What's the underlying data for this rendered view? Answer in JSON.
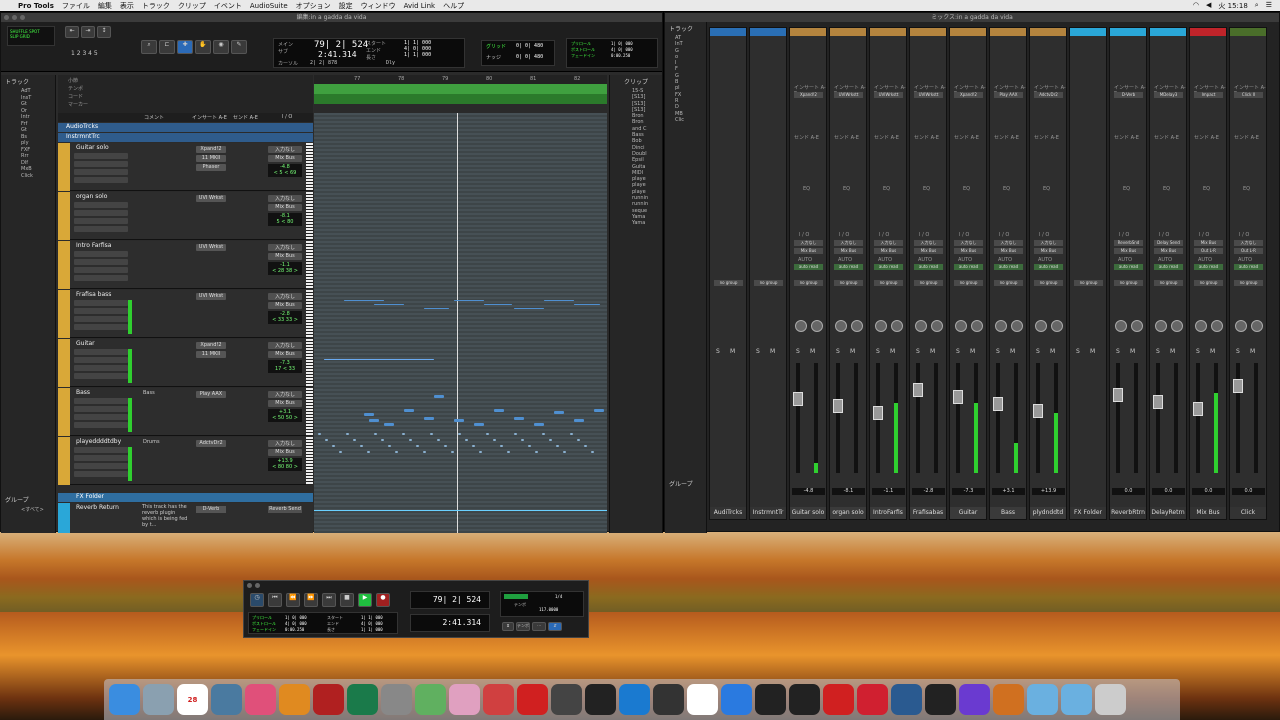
{
  "menubar": {
    "app": "Pro Tools",
    "items": [
      "ファイル",
      "編集",
      "表示",
      "トラック",
      "クリップ",
      "イベント",
      "AudioSuite",
      "オプション",
      "設定",
      "ウィンドウ",
      "Avid Link",
      "ヘルプ"
    ],
    "right": {
      "date": "火 15:18"
    }
  },
  "edit_window": {
    "title": "編集:in a gadda da vida",
    "counter_main": "79| 2| 524",
    "counter_sub": "2:41.314",
    "start": "1| 1| 000",
    "end": "4| 0| 000",
    "length": "1| 1| 000",
    "grid": "0| 0| 480",
    "nudge": "0| 0| 480",
    "cursor_label": "カーソル",
    "cursor_value": "2| 2| 878",
    "dly": "Dly",
    "tracks_label": "トラック",
    "clips_label": "クリップ",
    "group_label": "グループ",
    "group_all": "<すべて>",
    "track_list": [
      "AdT",
      "InsT",
      "Gt",
      "Or",
      "Intr",
      "Frf",
      "Gt",
      "Bs",
      "ply",
      "FXF",
      "Rrr",
      "Dlf",
      "MxB",
      "Click"
    ],
    "columns": [
      "コメント",
      "インサート A-E",
      "センド A-E",
      "I / O"
    ],
    "ruler_labels": [
      "小節",
      "テンポ",
      "コード",
      "マーカー"
    ],
    "folders": [
      "AudioTrcks",
      "InstrmntTrc"
    ],
    "fx_folder": "FX Folder",
    "reverb_track": "Reverb Return",
    "reverb_comment": "This track has the reverb plugin which is being fed by t...",
    "reverb_insert": "D-Verb",
    "reverb_io": "Reverb Send",
    "tracks": [
      {
        "name": "Guitar solo",
        "comment": "",
        "insert": "Xpand!2",
        "insert2": "11 MKII",
        "insert3": "Phaser",
        "io": "入力なし",
        "out": "Mix Bus",
        "vol": "-4.8",
        "pan": "< 5 < 69"
      },
      {
        "name": "organ solo",
        "comment": "",
        "insert": "UVI Wrkst",
        "insert2": "",
        "insert3": "",
        "io": "入力なし",
        "out": "Mix Bus",
        "vol": "-8.1",
        "pan": "5 < 80"
      },
      {
        "name": "Intro Farfisa",
        "comment": "",
        "insert": "UVI Wrkst",
        "insert2": "",
        "insert3": "",
        "io": "入力なし",
        "out": "Mix Bus",
        "vol": "-1.1",
        "pan": "< 28 38 >"
      },
      {
        "name": "Frafisa bass",
        "comment": "",
        "insert": "UVI Wrkst",
        "insert2": "",
        "insert3": "",
        "io": "入力なし",
        "out": "Mix Bus",
        "vol": "-2.8",
        "pan": "< 33 33 >"
      },
      {
        "name": "Guitar",
        "comment": "",
        "insert": "Xpand!2",
        "insert2": "11 MKII",
        "insert3": "",
        "io": "入力なし",
        "out": "Mix Bus",
        "vol": "-7.3",
        "pan": "17 < 33"
      },
      {
        "name": "Bass",
        "comment": "Bass",
        "insert": "Play AAX",
        "insert2": "",
        "insert3": "",
        "io": "入力なし",
        "out": "Mix Bus",
        "vol": "+3.1",
        "pan": "< 50 50 >"
      },
      {
        "name": "playeddddtdby",
        "comment": "Drums",
        "insert": "AdctvDr2",
        "insert2": "",
        "insert3": "",
        "io": "入力なし",
        "out": "Mix Bus",
        "vol": "+13.9",
        "pan": "< 80 80 >"
      }
    ],
    "bar_numbers": [
      "77",
      "78",
      "79",
      "80",
      "81",
      "82"
    ],
    "clip_list": [
      "15-S",
      "[S13]",
      "[S13]",
      "[S13]",
      "Bron",
      "Bron",
      "and C",
      "Bass",
      "Bob",
      "Dinci",
      "Doubl",
      "Epsil",
      "Guita",
      "MIDI",
      "playe",
      "playe",
      "playe",
      "runnin",
      "runnin",
      "seque",
      "Yama",
      "Yama"
    ],
    "clips_side": [
      "AT",
      "InT",
      "G",
      "o",
      "I",
      "F",
      "G",
      "B",
      "pl",
      "FX",
      "R",
      "D",
      "MB",
      "Clic"
    ]
  },
  "mix_window": {
    "title": "ミックス:in a gadda da vida",
    "channels": [
      {
        "name": "AudiTrcks",
        "insert": "",
        "io1": "",
        "io2": "",
        "vol": "",
        "color": "#2a6fb5"
      },
      {
        "name": "InstrmntTr",
        "insert": "",
        "io1": "",
        "io2": "",
        "vol": "",
        "color": "#2a6fb5"
      },
      {
        "name": "Guitar solo",
        "insert": "Xpand!2",
        "io1": "入力なし",
        "io2": "Mix Bus",
        "vol": "-4.8",
        "pk": "-9.4",
        "color": "#b4843e"
      },
      {
        "name": "organ solo",
        "insert": "UVIWrkstt",
        "io1": "入力なし",
        "io2": "Mix Bus",
        "vol": "-8.1",
        "pk": "-7.7",
        "color": "#b4843e"
      },
      {
        "name": "IntroFarfis",
        "insert": "UVIWrkstt",
        "io1": "入力なし",
        "io2": "Mix Bus",
        "vol": "-1.1",
        "pk": "-8.7",
        "color": "#b4843e"
      },
      {
        "name": "Frafisabas",
        "insert": "UVIWrkstt",
        "io1": "入力なし",
        "io2": "Mix Bus",
        "vol": "-2.8",
        "pk": "0.8",
        "color": "#b4843e"
      },
      {
        "name": "Guitar",
        "insert": "Xpand!2",
        "io1": "入力なし",
        "io2": "Mix Bus",
        "vol": "-7.3",
        "pk": "-2.2",
        "color": "#b4843e"
      },
      {
        "name": "Bass",
        "insert": "Play AAX",
        "io1": "入力なし",
        "io2": "Mix Bus",
        "vol": "+3.1",
        "pk": "-9.4",
        "color": "#b4843e"
      },
      {
        "name": "plydnddtd",
        "insert": "AdctvDr2",
        "io1": "入力なし",
        "io2": "Mix Bus",
        "vol": "+13.9",
        "pk": "-7.3",
        "color": "#b4843e"
      },
      {
        "name": "FX Folder",
        "insert": "",
        "io1": "",
        "io2": "",
        "vol": "",
        "color": "#2aa7d8"
      },
      {
        "name": "ReverbRtrn",
        "insert": "D-Verb",
        "io1": "ReverbSnd",
        "io2": "Mix Bus",
        "vol": "0.0",
        "pk": "",
        "color": "#2aa7d8"
      },
      {
        "name": "DelayRetrn",
        "insert": "MDelay3",
        "io1": "Delay Send",
        "io2": "Mix Bus",
        "vol": "0.0",
        "pk": "",
        "color": "#2aa7d8"
      },
      {
        "name": "Mix Bus",
        "insert": "Impact",
        "io1": "Mix Bus",
        "io2": "Out L-R",
        "vol": "0.0",
        "pk": "0.0",
        "color": "#c0242a"
      },
      {
        "name": "Click",
        "insert": "Click II",
        "io1": "入力なし",
        "io2": "Out L-R",
        "vol": "0.0",
        "pk": "",
        "color": "#4a6e2a"
      }
    ],
    "labels": {
      "inserts": "インサート A-E",
      "sends": "センド A-E",
      "eq": "EQ",
      "io": "I / O",
      "auto": "AUTO",
      "auto_read": "auto read",
      "group": "no group",
      "s": "S",
      "m": "M",
      "group_label": "グループ"
    }
  },
  "transport": {
    "counter_main": "79| 2| 524",
    "counter_sub": "2:41.314",
    "start": "1| 1| 000",
    "end": "4| 0| 000",
    "length": "1| 1| 000",
    "preroll": "プリロール",
    "postroll": "ポストロール",
    "fadein": "フェードイン",
    "pre_val": "1| 0| 000",
    "post_val": "4| 0| 000",
    "fade_val": "0:00.250",
    "start_lbl": "スタート",
    "end_lbl": "エンド",
    "len_lbl": "長さ",
    "tempo_label": "テンポ",
    "tempo": "117.0000",
    "meter": "1/4",
    "tempo_btn": "テンポ"
  },
  "dock": {
    "icons": [
      "finder-icon",
      "launchpad-icon",
      "calendar-icon",
      "preview-icon",
      "itunes-icon",
      "ibooks-icon",
      "photobooth-icon",
      "timemachine-icon",
      "syspref-icon",
      "maps-icon",
      "photos-icon",
      "guitar-icon",
      "pod-farm-icon",
      "mbox-icon",
      "piano-icon",
      "quicktime-icon",
      "iloK-icon",
      "x-icon",
      "safari-icon",
      "camera-icon",
      "wave-icon",
      "ew-icon",
      "ik-icon",
      "link-icon",
      "waves-icon",
      "protools-icon",
      "rt-icon",
      "folder-icon",
      "docs-icon",
      "trash-icon"
    ],
    "calendar_day": "28"
  }
}
